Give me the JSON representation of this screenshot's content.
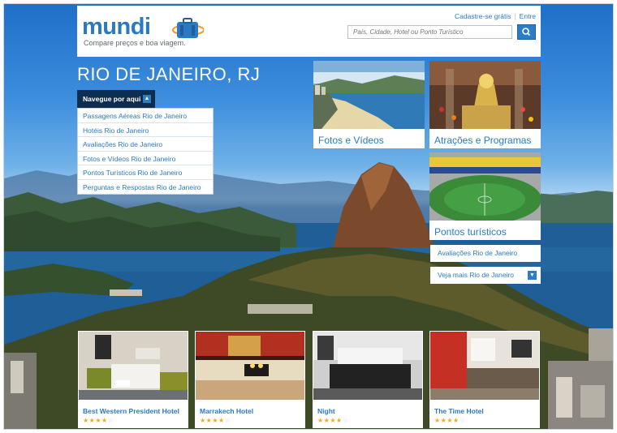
{
  "header": {
    "logo_text": "mundi",
    "tagline": "Compare preços e boa viagem.",
    "signup_link": "Cadastre-se grátis",
    "login_link": "Entre",
    "search_placeholder": "País, Cidade, Hotel ou Ponto Turístico",
    "search_icon": "search-icon"
  },
  "page": {
    "city_title": "RIO DE JANEIRO, RJ"
  },
  "nav": {
    "heading": "Navegue por aqui",
    "toggle_icon": "collapse-icon",
    "items": [
      {
        "label": "Passagens Aéreas Rio de Janeiro"
      },
      {
        "label": "Hotéis Rio de Janeiro"
      },
      {
        "label": "Avaliações Rio de Janeiro"
      },
      {
        "label": "Fotos e Vídeos Rio de Janeiro"
      },
      {
        "label": "Pontos Turísticos Rio de Janeiro"
      },
      {
        "label": "Perguntas e Respostas Rio de Janeiro"
      }
    ]
  },
  "tiles": {
    "photos": {
      "label": "Fotos e Vídeos"
    },
    "attractions": {
      "label": "Atrações e Programas"
    },
    "sights": {
      "label": "Pontos turísticos"
    }
  },
  "side_links": {
    "reviews": "Avaliações Rio de Janeiro",
    "more": "Veja mais Rio de Janeiro",
    "more_icon": "expand-icon"
  },
  "hotels": [
    {
      "name": "Best Western President Hotel",
      "rating": 4,
      "max_rating": 5
    },
    {
      "name": "Marrakech Hotel",
      "rating": 4,
      "max_rating": 5
    },
    {
      "name": "Night",
      "rating": 4,
      "max_rating": 5
    },
    {
      "name": "The Time Hotel",
      "rating": 4,
      "max_rating": 5
    }
  ],
  "colors": {
    "brand_blue": "#2b79c2",
    "nav_dark": "#0e2d4f",
    "star": "#f2a71c"
  }
}
